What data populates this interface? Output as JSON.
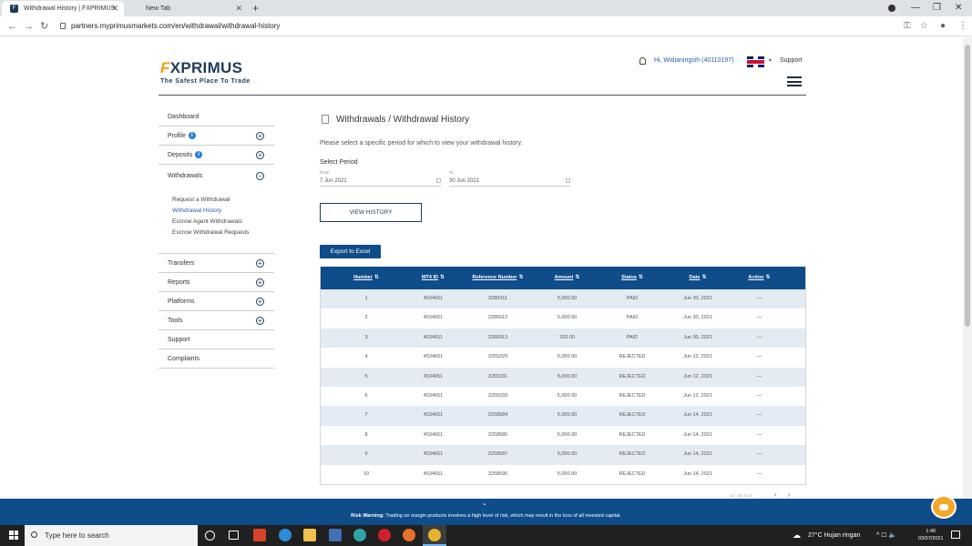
{
  "browser": {
    "tabs": [
      {
        "title": "Withdrawal History | FXPRIMUS",
        "active": true
      },
      {
        "title": "New Tab",
        "active": false
      }
    ],
    "new_tab_symbol": "+",
    "tab_close_symbol": "✕",
    "url": "partners.myprimusmarkets.com/en/withdrawal/withdrawal-history",
    "window_controls": {
      "minimize": "—",
      "restore": "❐",
      "close": "✕"
    },
    "nav": {
      "back": "←",
      "forward": "→",
      "reload": "↻"
    },
    "addr_icons": {
      "key": "⚿",
      "star": "☆",
      "profile": "●",
      "menu": "⋮"
    }
  },
  "header": {
    "logo_prefix": "F",
    "logo_text": "XPRIMUS",
    "tagline": "The Safest Place To Trade",
    "greeting": "Hi, Widianingsih (40110197)",
    "flag_caret": "▾",
    "support": "Support"
  },
  "sidebar": {
    "items": [
      {
        "label": "Dashboard"
      },
      {
        "label": "Profile",
        "info": "i",
        "toggle": "+"
      },
      {
        "label": "Deposits",
        "info": "i",
        "toggle": "+"
      },
      {
        "label": "Withdrawals",
        "toggle": "−"
      },
      {
        "label": "Transfers",
        "toggle": "+"
      },
      {
        "label": "Reports",
        "toggle": "+"
      },
      {
        "label": "Platforms",
        "toggle": "+"
      },
      {
        "label": "Tools",
        "toggle": "+"
      },
      {
        "label": "Support"
      },
      {
        "label": "Complaints"
      }
    ],
    "withdrawals_sub": [
      "Request a Withdrawal",
      "Withdrawal History",
      "Escrow Agent Withdrawals",
      "Escrow Withdrawal Requests"
    ]
  },
  "main": {
    "title": "Withdrawals / Withdrawal History",
    "instruction": "Please select a specific period for which to view your withdrawal history.",
    "select_period": "Select Period",
    "from_label": "From",
    "from_value": "7 Jun 2021",
    "to_label": "To",
    "to_value": "30 Jun 2021",
    "view_history": "VIEW HISTORY",
    "export": "Export to Excel"
  },
  "table": {
    "columns": [
      "Number",
      "MT4 ID",
      "Reference Number",
      "Amount",
      "Status",
      "Date",
      "Action"
    ],
    "sort_symbol": "⇅",
    "rows": [
      [
        "1",
        "4534651",
        "3286911",
        "5,000.00",
        "PAID",
        "Jun 30, 2021",
        "—"
      ],
      [
        "2",
        "4534651",
        "3286912",
        "5,000.00",
        "PAID",
        "Jun 30, 2021",
        "—"
      ],
      [
        "3",
        "4534651",
        "3286913",
        "220.00",
        "PAID",
        "Jun 30, 2021",
        "—"
      ],
      [
        "4",
        "4534651",
        "3255329",
        "5,000.00",
        "REJECTED",
        "Jun 12, 2021",
        "—"
      ],
      [
        "5",
        "4534651",
        "3255331",
        "5,000.00",
        "REJECTED",
        "Jun 12, 2021",
        "—"
      ],
      [
        "6",
        "4534651",
        "3255333",
        "5,000.00",
        "REJECTED",
        "Jun 12, 2021",
        "—"
      ],
      [
        "7",
        "4534651",
        "3258584",
        "5,000.00",
        "REJECTED",
        "Jun 14, 2021",
        "—"
      ],
      [
        "8",
        "4534651",
        "3258585",
        "5,000.00",
        "REJECTED",
        "Jun 14, 2021",
        "—"
      ],
      [
        "9",
        "4534651",
        "3258587",
        "5,000.00",
        "REJECTED",
        "Jun 14, 2021",
        "—"
      ],
      [
        "10",
        "4534651",
        "3258590",
        "5,000.00",
        "REJECTED",
        "Jun 14, 2021",
        "—"
      ]
    ],
    "pager_text": "11 - 20 of 20",
    "prev": "‹",
    "next": "›"
  },
  "risk_warning": {
    "chevron": "⌄",
    "label": "Risk Warning:",
    "text": " Trading on margin products involves a high level of risk, which may result in the loss of all invested capital."
  },
  "taskbar": {
    "search_placeholder": "Type here to search",
    "weather": "27°C  Hujan ringan",
    "time": "1:40",
    "date": "03/07/2021",
    "tray_symbols": "^  ☐  🔈"
  },
  "colors": {
    "brand_navy": "#1f3b57",
    "brand_blue": "#0f4c8a",
    "accent_orange": "#f39c12",
    "link_blue": "#2a5caa"
  }
}
